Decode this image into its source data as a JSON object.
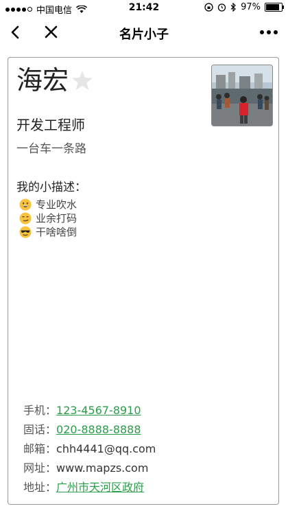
{
  "status_bar": {
    "carrier": "中国电信",
    "time": "21:42",
    "battery": "97%",
    "battery_level": 0.97
  },
  "nav": {
    "title": "名片小子"
  },
  "card": {
    "name": "海宏",
    "job_title": "开发工程师",
    "slogan": "一台车一条路",
    "description_title": "我的小描述：",
    "descriptions": [
      {
        "text": "专业吹水",
        "icon": "grinning-face-icon"
      },
      {
        "text": "业余打码",
        "icon": "smirking-face-icon"
      },
      {
        "text": "干啥啥倒",
        "icon": "sunglasses-face-icon"
      }
    ],
    "contacts": [
      {
        "label": "手机：",
        "value": "123-4567-8910",
        "link": true
      },
      {
        "label": "固话：",
        "value": "020-8888-8888",
        "link": true
      },
      {
        "label": "邮箱：",
        "value": "chh4441@qq.com",
        "link": false
      },
      {
        "label": "网址：",
        "value": "www.mapzs.com",
        "link": false
      },
      {
        "label": "地址：",
        "value": "广州市天河区政府",
        "link": true
      }
    ]
  },
  "colors": {
    "link": "#2a9d4a",
    "border": "#9a9a9a"
  }
}
